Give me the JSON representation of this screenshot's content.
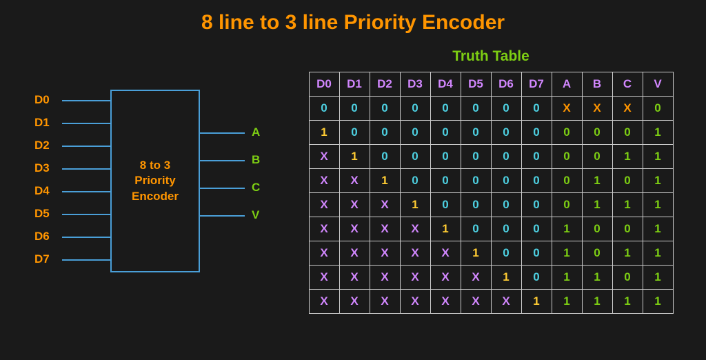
{
  "title": "8 line to 3 line Priority Encoder",
  "block": {
    "line1": "8 to 3",
    "line2": "Priority",
    "line3": "Encoder"
  },
  "inputs": [
    "D0",
    "D1",
    "D2",
    "D3",
    "D4",
    "D5",
    "D6",
    "D7"
  ],
  "outputs": [
    "A",
    "B",
    "C",
    "V"
  ],
  "truth_table": {
    "title": "Truth Table",
    "headers": [
      "D0",
      "D1",
      "D2",
      "D3",
      "D4",
      "D5",
      "D6",
      "D7",
      "A",
      "B",
      "C",
      "V"
    ],
    "rows": [
      [
        "0",
        "0",
        "0",
        "0",
        "0",
        "0",
        "0",
        "0",
        "X",
        "X",
        "X",
        "0"
      ],
      [
        "1",
        "0",
        "0",
        "0",
        "0",
        "0",
        "0",
        "0",
        "0",
        "0",
        "0",
        "1"
      ],
      [
        "X",
        "1",
        "0",
        "0",
        "0",
        "0",
        "0",
        "0",
        "0",
        "0",
        "1",
        "1"
      ],
      [
        "X",
        "X",
        "1",
        "0",
        "0",
        "0",
        "0",
        "0",
        "0",
        "1",
        "0",
        "1"
      ],
      [
        "X",
        "X",
        "X",
        "1",
        "0",
        "0",
        "0",
        "0",
        "0",
        "1",
        "1",
        "1"
      ],
      [
        "X",
        "X",
        "X",
        "X",
        "1",
        "0",
        "0",
        "0",
        "1",
        "0",
        "0",
        "1"
      ],
      [
        "X",
        "X",
        "X",
        "X",
        "X",
        "1",
        "0",
        "0",
        "1",
        "0",
        "1",
        "1"
      ],
      [
        "X",
        "X",
        "X",
        "X",
        "X",
        "X",
        "1",
        "0",
        "1",
        "1",
        "0",
        "1"
      ],
      [
        "X",
        "X",
        "X",
        "X",
        "X",
        "X",
        "X",
        "1",
        "1",
        "1",
        "1",
        "1"
      ]
    ]
  }
}
